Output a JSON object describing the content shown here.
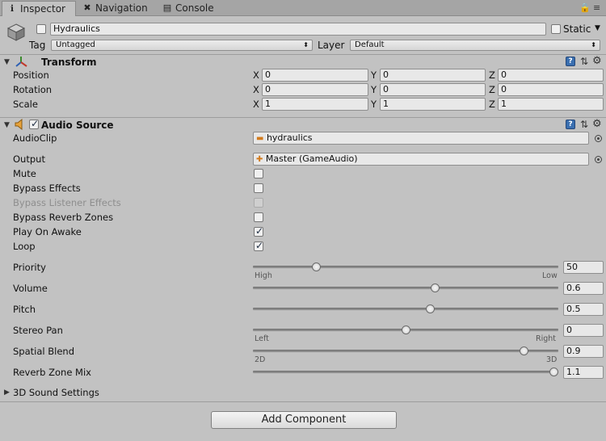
{
  "tabs": [
    {
      "label": "Inspector",
      "icon": "info-icon"
    },
    {
      "label": "Navigation",
      "icon": "navigation-icon"
    },
    {
      "label": "Console",
      "icon": "console-icon"
    }
  ],
  "gameobject": {
    "name": "Hydraulics",
    "active": false,
    "static_label": "Static",
    "static_checked": false,
    "tag_label": "Tag",
    "tag_value": "Untagged",
    "layer_label": "Layer",
    "layer_value": "Default"
  },
  "transform": {
    "title": "Transform",
    "rows": [
      {
        "label": "Position",
        "x": "0",
        "y": "0",
        "z": "0"
      },
      {
        "label": "Rotation",
        "x": "0",
        "y": "0",
        "z": "0"
      },
      {
        "label": "Scale",
        "x": "1",
        "y": "1",
        "z": "1"
      }
    ],
    "axis_x": "X",
    "axis_y": "Y",
    "axis_z": "Z"
  },
  "audio_source": {
    "title": "Audio Source",
    "enabled": true,
    "audioclip_label": "AudioClip",
    "audioclip_value": "hydraulics",
    "output_label": "Output",
    "output_value": "Master (GameAudio)",
    "toggles": [
      {
        "label": "Mute",
        "checked": false,
        "disabled": false
      },
      {
        "label": "Bypass Effects",
        "checked": false,
        "disabled": false
      },
      {
        "label": "Bypass Listener Effects",
        "checked": false,
        "disabled": true
      },
      {
        "label": "Bypass Reverb Zones",
        "checked": false,
        "disabled": false
      },
      {
        "label": "Play On Awake",
        "checked": true,
        "disabled": false
      },
      {
        "label": "Loop",
        "checked": true,
        "disabled": false
      }
    ],
    "sliders": [
      {
        "label": "Priority",
        "value": "50",
        "fraction": 0.2,
        "min_label": "High",
        "max_label": "Low"
      },
      {
        "label": "Volume",
        "value": "0.6",
        "fraction": 0.6,
        "min_label": "",
        "max_label": ""
      },
      {
        "label": "Pitch",
        "value": "0.5",
        "fraction": 0.584,
        "min_label": "",
        "max_label": ""
      },
      {
        "label": "Stereo Pan",
        "value": "0",
        "fraction": 0.5,
        "min_label": "Left",
        "max_label": "Right"
      },
      {
        "label": "Spatial Blend",
        "value": "0.9",
        "fraction": 0.9,
        "min_label": "2D",
        "max_label": "3D"
      },
      {
        "label": "Reverb Zone Mix",
        "value": "1.1",
        "fraction": 1.0,
        "min_label": "",
        "max_label": ""
      }
    ],
    "sound_settings_label": "3D Sound Settings"
  },
  "add_component_label": "Add Component"
}
